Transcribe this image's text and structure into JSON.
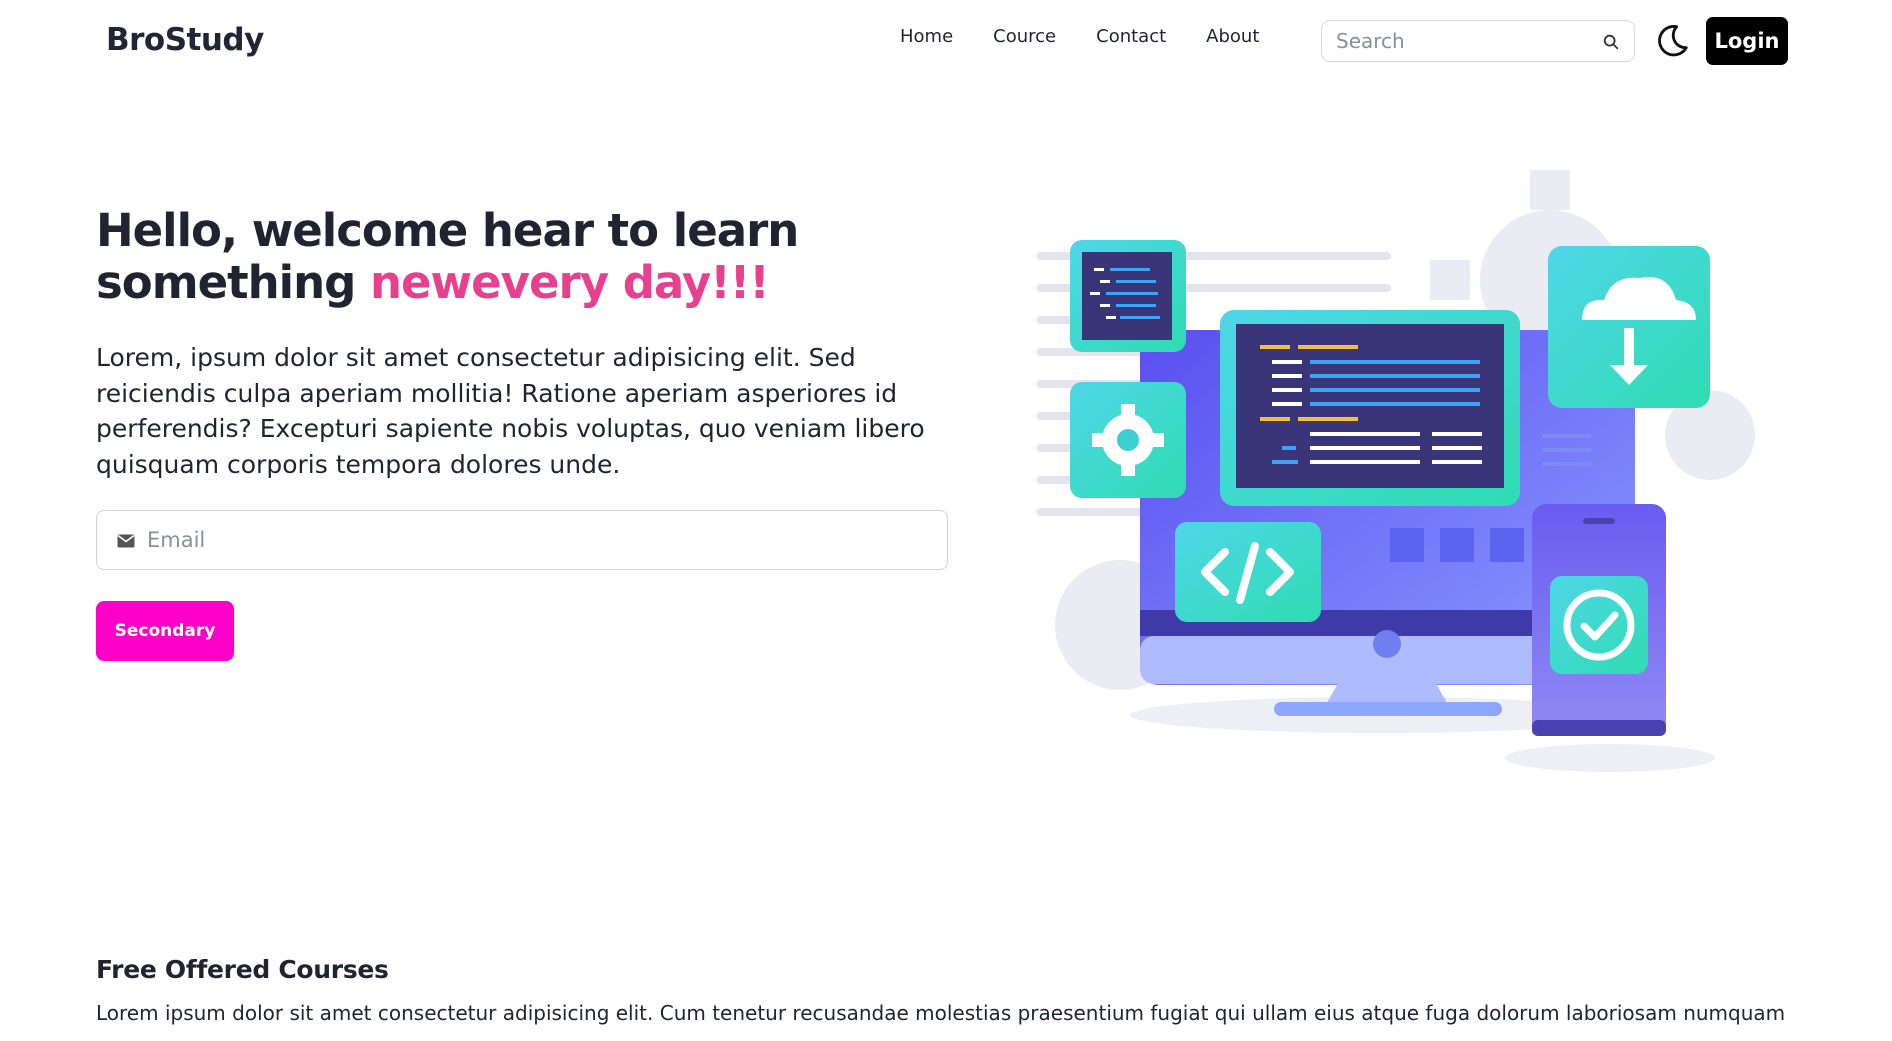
{
  "navbar": {
    "brand": "BroStudy",
    "links": [
      "Home",
      "Cource",
      "Contact",
      "About"
    ],
    "search_placeholder": "Search",
    "login_label": "Login"
  },
  "hero": {
    "title_main": "Hello, welcome hear to learn something ",
    "title_accent": "newevery day!!!",
    "description": "Lorem, ipsum dolor sit amet consectetur adipisicing elit. Sed reiciendis culpa aperiam mollitia! Ratione aperiam asperiores id perferendis? Excepturi sapiente nobis voluptas, quo veniam libero quisquam corporis tempora dolores unde.",
    "email_placeholder": "Email",
    "button_label": "Secondary"
  },
  "courses": {
    "title": "Free Offered Courses",
    "description": "Lorem ipsum dolor sit amet consectetur adipisicing elit. Cum tenetur recusandae molestias praesentium fugiat qui ullam eius atque fuga dolorum laboriosam numquam"
  },
  "colors": {
    "accent": "#e6408f",
    "button": "#ff00c8",
    "login": "#000000"
  },
  "icons": [
    "search-icon",
    "moon-icon",
    "mail-icon",
    "gear-icon",
    "code-icon",
    "cloud-download-icon",
    "check-circle-icon"
  ]
}
